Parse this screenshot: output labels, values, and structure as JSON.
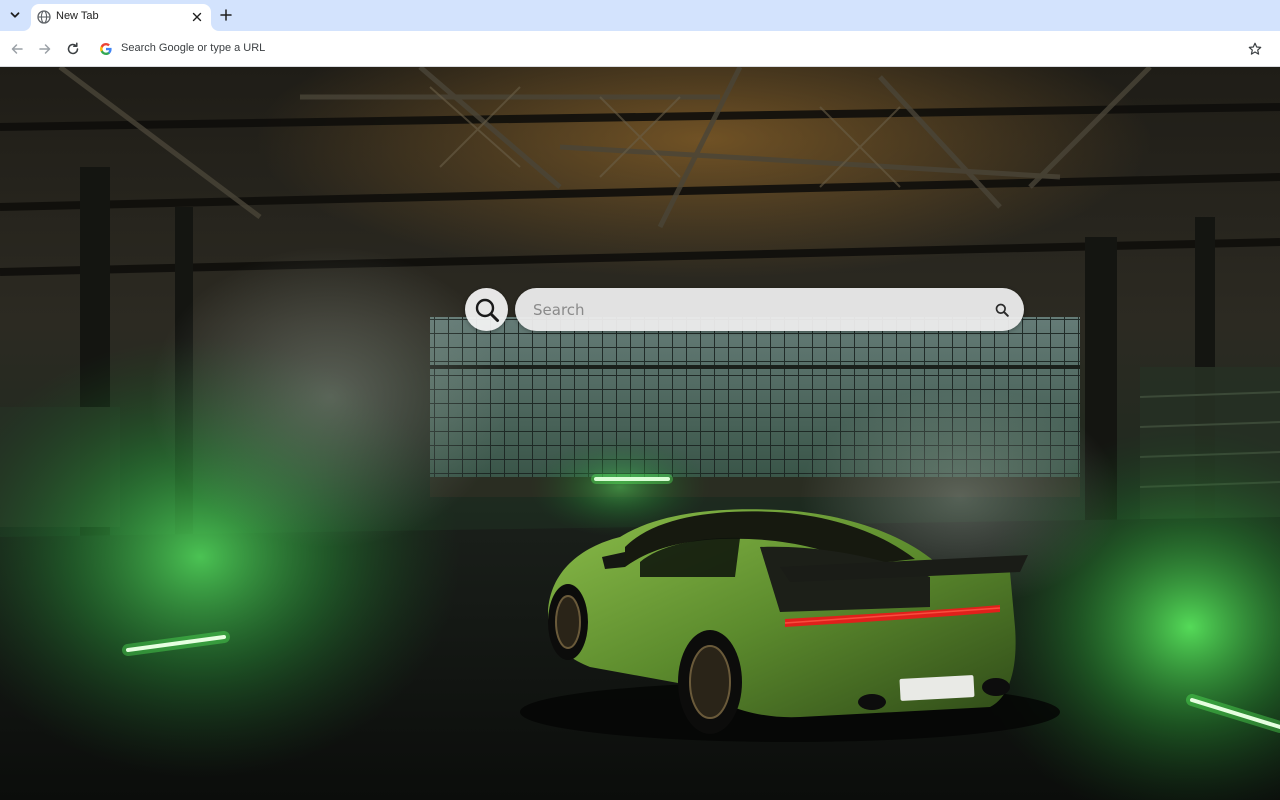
{
  "browser": {
    "tab": {
      "title": "New Tab"
    },
    "omnibox": {
      "placeholder": "Search Google or type a URL"
    }
  },
  "ntp": {
    "search": {
      "placeholder": "Search"
    },
    "background": {
      "description_icon": "car-in-warehouse-photo"
    }
  },
  "colors": {
    "tabstrip": "#d3e3fd",
    "accent_green": "#39ff3a",
    "car_green": "#5f8f2e",
    "taillight_red": "#e0201b"
  },
  "icons": [
    "tab-search-icon",
    "globe-icon",
    "close-icon",
    "plus-icon",
    "back-icon",
    "forward-icon",
    "reload-icon",
    "google-g-icon",
    "star-icon",
    "magnifier-icon",
    "search-icon"
  ]
}
